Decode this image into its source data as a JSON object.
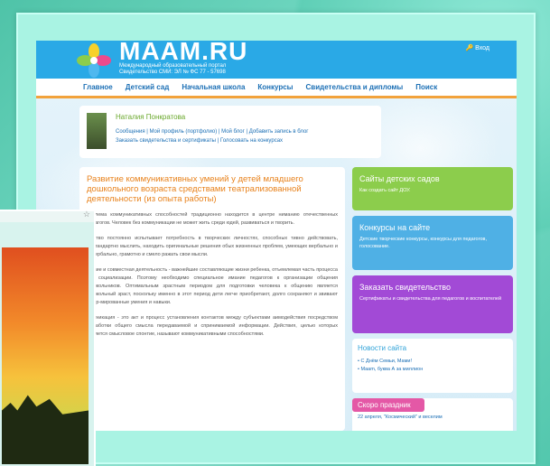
{
  "site": {
    "logo_text": "MAAM.RU",
    "logo_sub_line1": "Международный образовательный портал",
    "logo_sub_line2": "Свидетельство СМИ: ЭЛ № ФС 77 - 57698",
    "login_label": "Вход"
  },
  "nav": {
    "items": [
      "Главное",
      "Детский сад",
      "Начальная школа",
      "Конкурсы",
      "Свидетельства и дипломы",
      "Поиск"
    ]
  },
  "profile": {
    "name": "Наталия Понкратова",
    "links_line1": "Сообщения | Мой профиль (портфолио) | Мой блог | Добавить запись в блог",
    "links_line2": "Заказать свидетельства и сертификаты | Голосовать на конкурсах"
  },
  "article": {
    "title": "Развитие коммуникативных умений у детей младшего дошкольного возраста средствами театрализованной деятельности (из опыта работы)",
    "paragraphs": [
      "роблема коммуникативных способностей традиционно находится в центре ниманию отечественных педагогов. Человек без коммуникации не может жить среди юдей, развиваться и творить.",
      "ществo постоянно испытывает потребность в творческих личностях, способных тивно действовать, нестандартно мыслить, находить оригинальные решения обых жизненных проблем, умеющих вербально и невербально, грамотно и смело ражать свои мысли.",
      "щение и совместная деятельность - важнейшие составляющие жизни ребенка, отъемлемая часть процесса его социализации. Поэтому необходимо специальное имание педагогов к организации общения дошкольников. Оптимальным зрастным периодом для подготовки человека к общению является дошкольный зраст, поскольку именно в этот период дети легче приобретают, долго сохраняют и звивают сфер-мированные умения и навыки.",
      "ммуникация - это акт и процесс установления контактов между субъектами аимодействия посредством выработки общего смысла передаваемой и спринимаемой информации. Действия, целью которых является смысловое спонтие, называют коммуникативными способностями."
    ]
  },
  "sidebar": {
    "box1_title": "Сайты детских садов",
    "box1_text": "Как создать сайт ДОУ.",
    "box2_title": "Конкурсы на сайте",
    "box2_text": "Детские творческие конкурсы, конкурсы для педагогов, голосование.",
    "box3_title": "Заказать свидетельство",
    "box3_text": "Сертификаты и свидетельства для педагогов и воспитателей",
    "news_title": "Новости сайта",
    "news_items": [
      "С Днём Семьи, Мами!",
      "Мааm, буква А за миллион"
    ],
    "holiday_title": "Скоро праздник",
    "holiday_text": "22 апреля, \"Космический\" и веселим"
  },
  "colors": {
    "topbar": "#2aa9e6",
    "box1": "#8ccd4c",
    "box2": "#4fb0e5",
    "box3": "#a24ad6",
    "accent_orange": "#e8821c"
  }
}
